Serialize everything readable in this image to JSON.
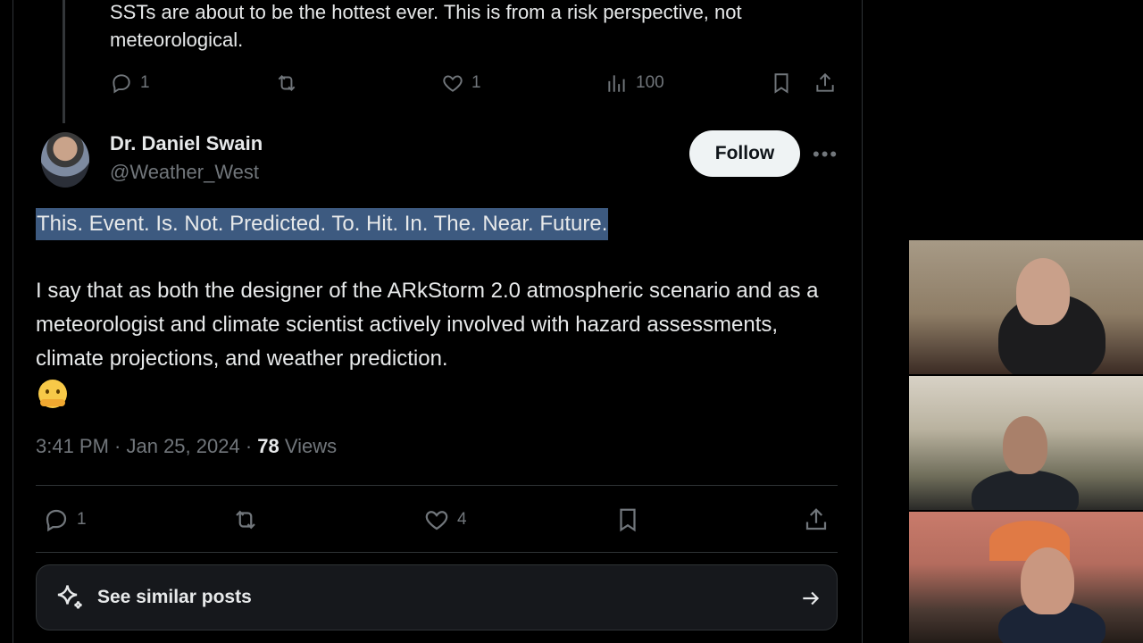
{
  "previous_post": {
    "text": "SSTs are about to be the hottest ever. This is from a risk perspective, not meteorological.",
    "reply_count": "1",
    "like_count": "1",
    "view_count": "100"
  },
  "post": {
    "author_name": "Dr. Daniel Swain",
    "author_handle": "@Weather_West",
    "follow_label": "Follow",
    "highlighted_text": "This. Event. Is. Not. Predicted. To. Hit. In. The. Near. Future.",
    "body_text": "I say that as both the designer of the ARkStorm 2.0 atmospheric scenario and as a meteorologist and climate scientist actively involved with hazard assessments, climate projections, and weather prediction.",
    "emoji_icon": "hugging-face-emoji",
    "timestamp": "3:41 PM · Jan 25, 2024",
    "views_separator": " · ",
    "views_count": "78",
    "views_label": " Views",
    "reply_count": "1",
    "like_count": "4"
  },
  "see_similar": {
    "label": "See similar posts"
  },
  "colors": {
    "background": "#000000",
    "text_primary": "#e7e9ea",
    "text_secondary": "#71767b",
    "highlight": "#3d5a80",
    "follow_bg": "#eff3f4"
  }
}
